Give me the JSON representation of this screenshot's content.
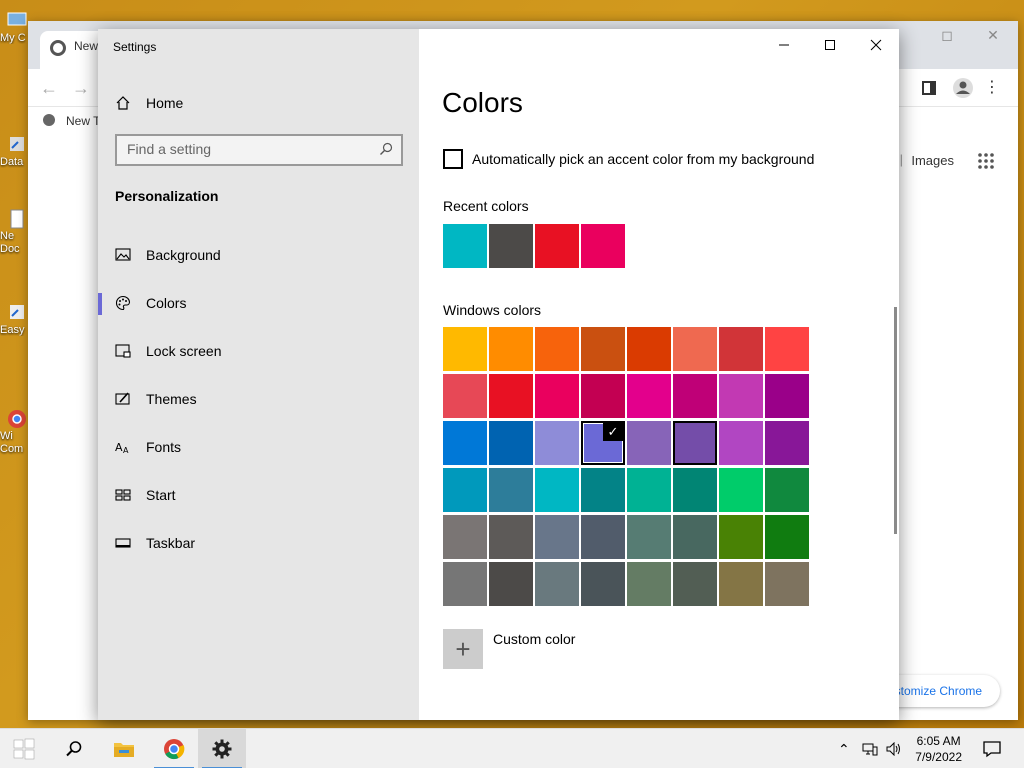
{
  "desktop": {
    "icons": [
      "My C",
      "Data",
      "Ne Doc",
      "Easy",
      "Wi Com"
    ]
  },
  "chrome": {
    "tab_title": "New",
    "bookmark": "New T",
    "images_link": "Images",
    "customize_link": "ustomize Chrome"
  },
  "settings": {
    "app_title": "Settings",
    "home": "Home",
    "search_placeholder": "Find a setting",
    "section": "Personalization",
    "nav": [
      {
        "label": "Background",
        "icon": "image-icon"
      },
      {
        "label": "Colors",
        "icon": "palette-icon"
      },
      {
        "label": "Lock screen",
        "icon": "lock-screen-icon"
      },
      {
        "label": "Themes",
        "icon": "themes-icon"
      },
      {
        "label": "Fonts",
        "icon": "fonts-icon"
      },
      {
        "label": "Start",
        "icon": "start-icon"
      },
      {
        "label": "Taskbar",
        "icon": "taskbar-icon"
      }
    ],
    "active_nav": "Colors",
    "page_title": "Colors",
    "auto_pick_label": "Automatically pick an accent color from my background",
    "auto_pick_checked": false,
    "recent_label": "Recent colors",
    "recent_colors": [
      "#00b7c3",
      "#4c4a48",
      "#e81123",
      "#ea005e"
    ],
    "windows_label": "Windows colors",
    "windows_colors": [
      [
        "#ffb900",
        "#ff8c00",
        "#f7630c",
        "#ca5010",
        "#da3b01",
        "#ef6950",
        "#d13438",
        "#ff4343"
      ],
      [
        "#e74856",
        "#e81123",
        "#ea005e",
        "#c30052",
        "#e3008c",
        "#bf0077",
        "#c239b3",
        "#9a0089"
      ],
      [
        "#0078d7",
        "#0063b1",
        "#8e8cd8",
        "#6b69d6",
        "#8764b8",
        "#744da9",
        "#b146c2",
        "#881798"
      ],
      [
        "#0099bc",
        "#2d7d9a",
        "#00b7c3",
        "#038387",
        "#00b294",
        "#018574",
        "#00cc6a",
        "#10893e"
      ],
      [
        "#7a7574",
        "#5d5a58",
        "#68768a",
        "#515c6b",
        "#567c73",
        "#486860",
        "#498205",
        "#107c10"
      ],
      [
        "#767676",
        "#4c4a48",
        "#69797e",
        "#4a5459",
        "#647c64",
        "#525e54",
        "#847545",
        "#7e735f"
      ]
    ],
    "selected_color": {
      "row": 2,
      "col": 3
    },
    "hover_color": {
      "row": 2,
      "col": 5
    },
    "custom_label": "Custom color"
  },
  "taskbar": {
    "time": "6:05 AM",
    "date": "7/9/2022"
  }
}
